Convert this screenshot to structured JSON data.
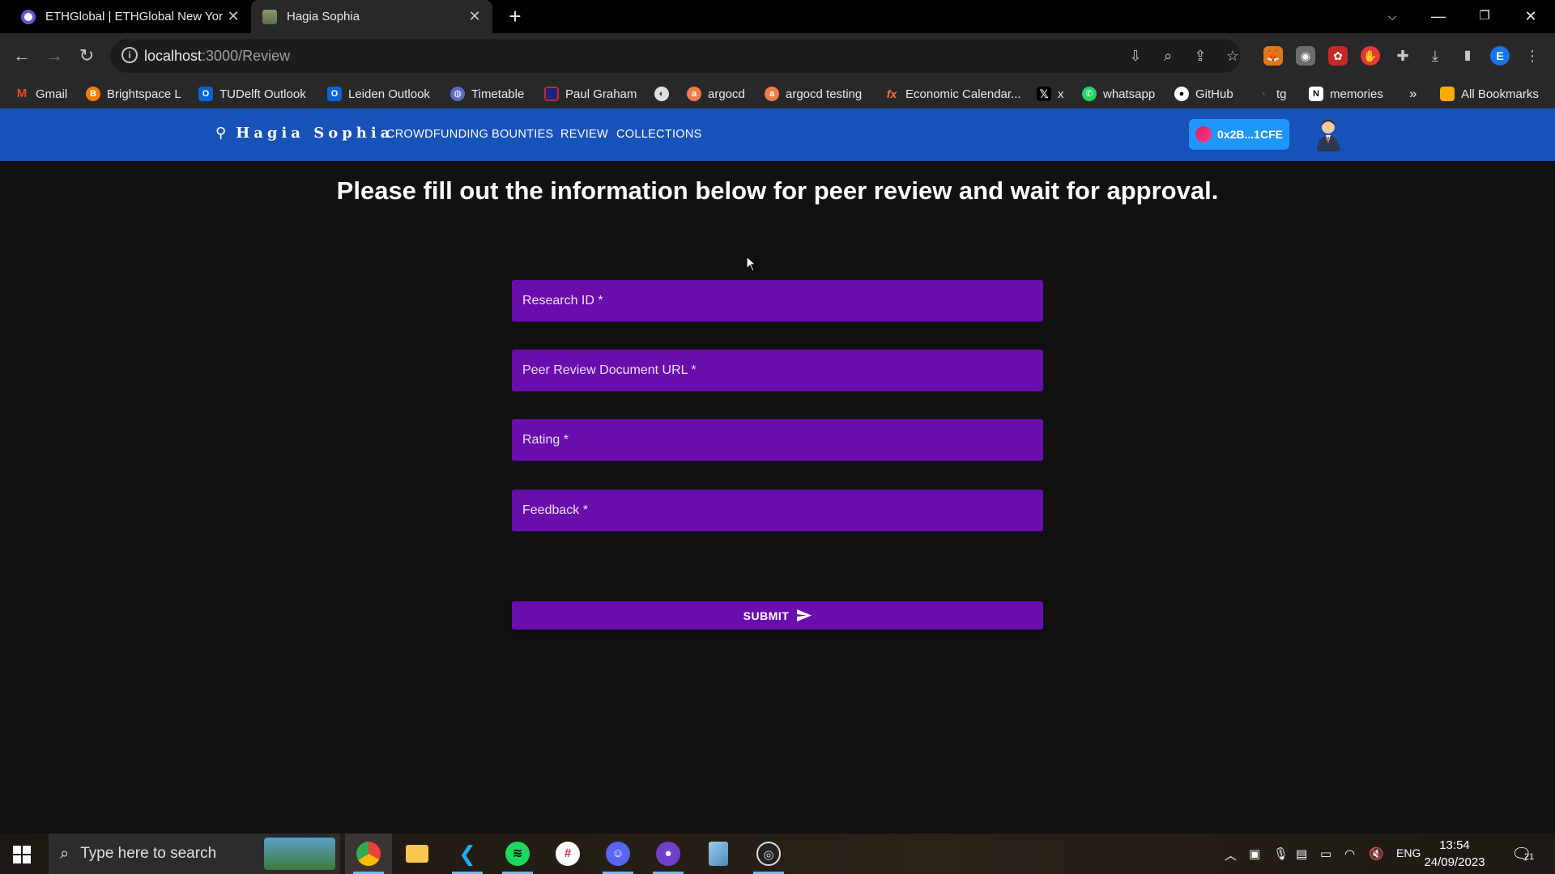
{
  "browser": {
    "tabs": [
      {
        "title": "ETHGlobal | ETHGlobal New York",
        "active": false
      },
      {
        "title": "Hagia Sophia",
        "active": true
      }
    ],
    "url_host": "localhost",
    "url_path": ":3000/Review",
    "profile_initial": "E",
    "bookmarks": [
      "Gmail",
      "Brightspace L",
      "TUDelft Outlook",
      "Leiden Outlook",
      "Timetable",
      "Paul Graham",
      "argocd",
      "argocd testing",
      "Economic Calendar...",
      "x",
      "whatsapp",
      "GitHub",
      "tg",
      "memories"
    ],
    "bookmarks_more": "»",
    "all_bookmarks": "All Bookmarks"
  },
  "app": {
    "brand": "Hagia Sophia",
    "nav": [
      "CROWDFUNDING",
      "BOUNTIES",
      "REVIEW",
      "COLLECTIONS"
    ],
    "wallet": "0x2B...1CFE",
    "headline": "Please fill out the information below for peer review and wait for approval.",
    "form": {
      "research_id": {
        "placeholder": "Research ID *",
        "value": ""
      },
      "document_url": {
        "placeholder": "Peer Review Document URL *",
        "value": ""
      },
      "rating": {
        "placeholder": "Rating *",
        "value": ""
      },
      "feedback": {
        "placeholder": "Feedback *",
        "value": ""
      },
      "submit_label": "SUBMIT"
    },
    "colors": {
      "appbar": "#1752b8",
      "field": "#6a0dad",
      "wallet": "#1e96fc",
      "background": "#111111"
    }
  },
  "taskbar": {
    "search_placeholder": "Type here to search",
    "language": "ENG",
    "time": "13:54",
    "date": "24/09/2023",
    "notifications": "21"
  }
}
